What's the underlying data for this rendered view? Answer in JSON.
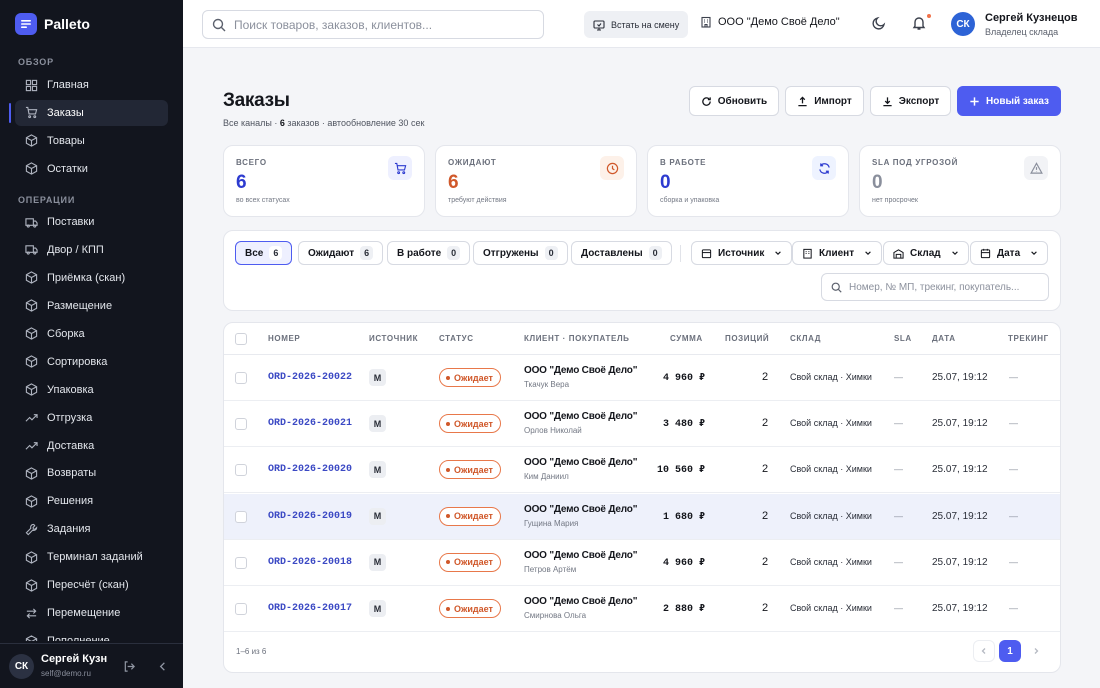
{
  "brand": {
    "name": "Palleto"
  },
  "sidebar": {
    "sections": [
      {
        "title": "ОБЗОР",
        "items": [
          {
            "label": "Главная",
            "icon": "grid-icon"
          },
          {
            "label": "Заказы",
            "icon": "cart-icon",
            "active": true
          },
          {
            "label": "Товары",
            "icon": "box-icon"
          },
          {
            "label": "Остатки",
            "icon": "box-icon"
          }
        ]
      },
      {
        "title": "ОПЕРАЦИИ",
        "items": [
          {
            "label": "Поставки",
            "icon": "truck-icon"
          },
          {
            "label": "Двор / КПП",
            "icon": "truck-icon"
          },
          {
            "label": "Приёмка (скан)",
            "icon": "box-icon"
          },
          {
            "label": "Размещение",
            "icon": "box-icon"
          },
          {
            "label": "Сборка",
            "icon": "box-icon"
          },
          {
            "label": "Сортировка",
            "icon": "box-icon"
          },
          {
            "label": "Упаковка",
            "icon": "box-icon"
          },
          {
            "label": "Отгрузка",
            "icon": "trend-icon"
          },
          {
            "label": "Доставка",
            "icon": "trend-icon"
          },
          {
            "label": "Возвраты",
            "icon": "box-icon"
          },
          {
            "label": "Решения",
            "icon": "box-icon"
          },
          {
            "label": "Задания",
            "icon": "wrench-icon"
          },
          {
            "label": "Терминал заданий",
            "icon": "box-icon"
          },
          {
            "label": "Пересчёт (скан)",
            "icon": "box-icon"
          },
          {
            "label": "Перемещение",
            "icon": "swap-icon"
          },
          {
            "label": "Пополнение",
            "icon": "box-icon"
          }
        ]
      }
    ],
    "user": {
      "initials": "СК",
      "name": "Сергей Кузнецов",
      "email": "self@demo.ru"
    }
  },
  "topbar": {
    "search_placeholder": "Поиск товаров, заказов, клиентов...",
    "shift_label": "Встать на смену",
    "org": "ООО \"Демо Своё Дело\"",
    "user": {
      "initials": "СК",
      "name": "Сергей Кузнецов",
      "role": "Владелец склада"
    }
  },
  "page": {
    "title": "Заказы",
    "subtitle_prefix": "Все каналы · ",
    "subtitle_count": "6",
    "subtitle_suffix": " заказов · автообновление 30 сек",
    "buttons": {
      "refresh": "Обновить",
      "import": "Импорт",
      "export": "Экспорт",
      "new": "Новый заказ"
    }
  },
  "stats": [
    {
      "label": "ВСЕГО",
      "value": "6",
      "sub": "во всех статусах",
      "color": "#2d3bd0",
      "icon": "cart-icon",
      "icon_bg": "#eef0ff"
    },
    {
      "label": "ОЖИДАЮТ",
      "value": "6",
      "sub": "требуют действия",
      "color": "#d0582a",
      "icon": "clock-icon",
      "icon_bg": "#fdf1e9"
    },
    {
      "label": "В РАБОТЕ",
      "value": "0",
      "sub": "сборка и упаковка",
      "color": "#2d3bd0",
      "icon": "refresh-icon",
      "icon_bg": "#eef3ff"
    },
    {
      "label": "SLA ПОД УГРОЗОЙ",
      "value": "0",
      "sub": "нет просрочек",
      "color": "#8a8f9c",
      "icon": "warning-icon",
      "icon_bg": "#f2f3f6"
    }
  ],
  "filters": {
    "chips": [
      {
        "label": "Все",
        "count": "6",
        "active": true
      },
      {
        "label": "Ожидают",
        "count": "6"
      },
      {
        "label": "В работе",
        "count": "0"
      },
      {
        "label": "Отгружены",
        "count": "0"
      },
      {
        "label": "Доставлены",
        "count": "0"
      }
    ],
    "dropdowns": [
      "Источник",
      "Клиент",
      "Склад",
      "Дата"
    ],
    "search_placeholder": "Номер, № МП, трекинг, покупатель..."
  },
  "table": {
    "columns": [
      "НОМЕР",
      "ИСТОЧНИК",
      "СТАТУС",
      "КЛИЕНТ · ПОКУПАТЕЛЬ",
      "СУММА",
      "ПОЗИЦИЙ",
      "СКЛАД",
      "SLA",
      "ДАТА",
      "ТРЕКИНГ"
    ],
    "rows": [
      {
        "number": "ORD-2026-20022",
        "source": "M",
        "status": "Ожидает",
        "client": "ООО \"Демо Своё Дело\"",
        "buyer": "Ткачук Вера",
        "sum": "4 960 ₽",
        "positions": "2",
        "warehouse": "Свой склад · Химки",
        "sla": "—",
        "date": "25.07, 19:12",
        "tracking": "—"
      },
      {
        "number": "ORD-2026-20021",
        "source": "M",
        "status": "Ожидает",
        "client": "ООО \"Демо Своё Дело\"",
        "buyer": "Орлов Николай",
        "sum": "3 480 ₽",
        "positions": "2",
        "warehouse": "Свой склад · Химки",
        "sla": "—",
        "date": "25.07, 19:12",
        "tracking": "—"
      },
      {
        "number": "ORD-2026-20020",
        "source": "M",
        "status": "Ожидает",
        "client": "ООО \"Демо Своё Дело\"",
        "buyer": "Ким Даниил",
        "sum": "10 560 ₽",
        "positions": "2",
        "warehouse": "Свой склад · Химки",
        "sla": "—",
        "date": "25.07, 19:12",
        "tracking": "—"
      },
      {
        "number": "ORD-2026-20019",
        "source": "M",
        "status": "Ожидает",
        "client": "ООО \"Демо Своё Дело\"",
        "buyer": "Гущина Мария",
        "sum": "1 680 ₽",
        "positions": "2",
        "warehouse": "Свой склад · Химки",
        "sla": "—",
        "date": "25.07, 19:12",
        "tracking": "—",
        "highlighted": true
      },
      {
        "number": "ORD-2026-20018",
        "source": "M",
        "status": "Ожидает",
        "client": "ООО \"Демо Своё Дело\"",
        "buyer": "Петров Артём",
        "sum": "4 960 ₽",
        "positions": "2",
        "warehouse": "Свой склад · Химки",
        "sla": "—",
        "date": "25.07, 19:12",
        "tracking": "—"
      },
      {
        "number": "ORD-2026-20017",
        "source": "M",
        "status": "Ожидает",
        "client": "ООО \"Демо Своё Дело\"",
        "buyer": "Смирнова Ольга",
        "sum": "2 880 ₽",
        "positions": "2",
        "warehouse": "Свой склад · Химки",
        "sla": "—",
        "date": "25.07, 19:12",
        "tracking": "—"
      }
    ],
    "footer": "1–6 из 6",
    "pages": [
      "1"
    ],
    "current_page": "1"
  },
  "colors": {
    "accent": "#4e5cf0",
    "pending": "#d0582a",
    "sidebar_bg": "#12151e"
  }
}
